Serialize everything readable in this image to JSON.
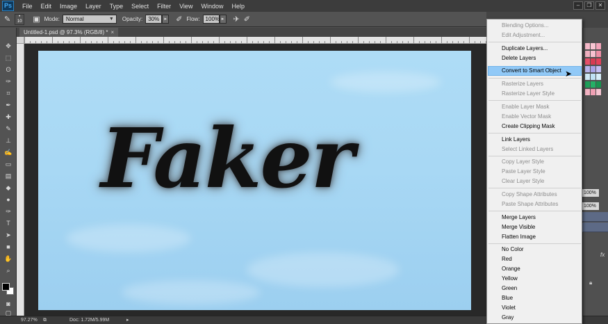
{
  "app": {
    "logo": "Ps"
  },
  "menubar": {
    "items": [
      "File",
      "Edit",
      "Image",
      "Layer",
      "Type",
      "Select",
      "Filter",
      "View",
      "Window",
      "Help"
    ]
  },
  "window_controls": {
    "minimize": "–",
    "restore": "❐",
    "close": "✕"
  },
  "options_bar": {
    "brush_size": "10",
    "mode_label": "Mode:",
    "mode_value": "Normal",
    "opacity_label": "Opacity:",
    "opacity_value": "30%",
    "flow_label": "Flow:",
    "flow_value": "100%"
  },
  "document_tab": {
    "title": "Untitled-1.psd @ 97.3% (RGB/8) *",
    "close": "×"
  },
  "canvas": {
    "text": "Faker",
    "sky_color": "#a8d8f4"
  },
  "status_bar": {
    "zoom": "97.27%",
    "doc_info": "Doc: 1.72M/5.99M"
  },
  "panels": {
    "opacity_value": "100%",
    "fill_value": "100%",
    "fx_label": "fx"
  },
  "context_menu": {
    "items": [
      {
        "label": "Blending Options...",
        "enabled": false
      },
      {
        "label": "Edit Adjustment...",
        "enabled": false
      },
      {
        "label": "Duplicate Layers...",
        "enabled": true
      },
      {
        "label": "Delete Layers",
        "enabled": true
      },
      {
        "label": "Convert to Smart Object",
        "enabled": true,
        "highlighted": true
      },
      {
        "label": "Rasterize Layers",
        "enabled": false
      },
      {
        "label": "Rasterize Layer Style",
        "enabled": false
      },
      {
        "label": "Enable Layer Mask",
        "enabled": false
      },
      {
        "label": "Enable Vector Mask",
        "enabled": false
      },
      {
        "label": "Create Clipping Mask",
        "enabled": true
      },
      {
        "label": "Link Layers",
        "enabled": true
      },
      {
        "label": "Select Linked Layers",
        "enabled": false
      },
      {
        "label": "Copy Layer Style",
        "enabled": false
      },
      {
        "label": "Paste Layer Style",
        "enabled": false
      },
      {
        "label": "Clear Layer Style",
        "enabled": false
      },
      {
        "label": "Copy Shape Attributes",
        "enabled": false
      },
      {
        "label": "Paste Shape Attributes",
        "enabled": false
      },
      {
        "label": "Merge Layers",
        "enabled": true
      },
      {
        "label": "Merge Visible",
        "enabled": true
      },
      {
        "label": "Flatten Image",
        "enabled": true
      },
      {
        "label": "No Color",
        "enabled": true
      },
      {
        "label": "Red",
        "enabled": true
      },
      {
        "label": "Orange",
        "enabled": true
      },
      {
        "label": "Yellow",
        "enabled": true
      },
      {
        "label": "Green",
        "enabled": true
      },
      {
        "label": "Blue",
        "enabled": true
      },
      {
        "label": "Violet",
        "enabled": true
      },
      {
        "label": "Gray",
        "enabled": true
      }
    ]
  }
}
